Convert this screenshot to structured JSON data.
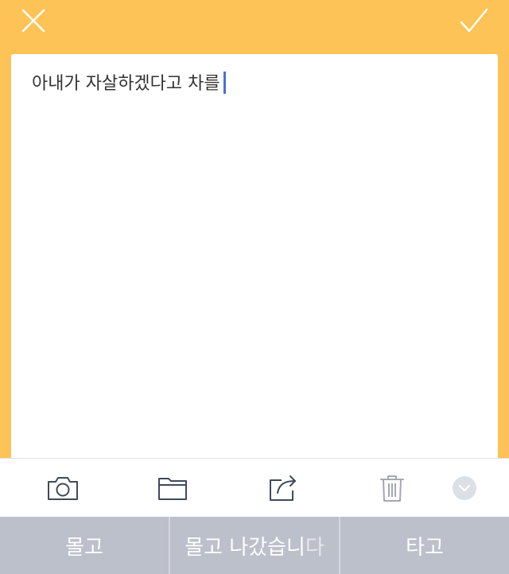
{
  "colors": {
    "header_bg": "#FEC356",
    "card_bg": "#FFFFFF",
    "text": "#333333",
    "caret": "#4A6FD8",
    "toolbar_icon": "#3F4A5A",
    "suggestion_bar_bg": "#BCC0CB"
  },
  "header": {
    "close_icon": "close-icon",
    "confirm_icon": "checkmark-icon"
  },
  "note": {
    "text": "아내가 자살하겠다고 차를"
  },
  "toolbar": {
    "icons": [
      "camera-icon",
      "folder-icon",
      "share-icon",
      "trash-icon",
      "chevron-down-icon"
    ]
  },
  "keyboard_suggestions": {
    "left": "몰고",
    "center_main": "몰고 나갔습니",
    "center_faded": "다",
    "right": "타고"
  }
}
